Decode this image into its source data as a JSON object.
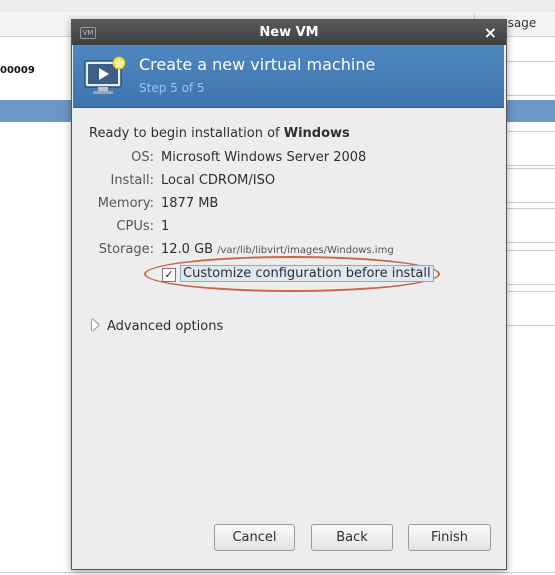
{
  "background": {
    "column_header": "usage",
    "row_label": "00009"
  },
  "dialog": {
    "title": "New VM",
    "app_icon_text": "VM",
    "close_glyph": "×",
    "banner": {
      "heading": "Create a new virtual machine",
      "step": "Step 5 of 5"
    },
    "ready_prefix": "Ready to begin installation of ",
    "os_name": "Windows",
    "details": [
      {
        "label": "OS:",
        "value": "Microsoft Windows Server 2008"
      },
      {
        "label": "Install:",
        "value": "Local CDROM/ISO"
      },
      {
        "label": "Memory:",
        "value": "1877 MB"
      },
      {
        "label": "CPUs:",
        "value": "1"
      },
      {
        "label": "Storage:",
        "value": "12.0 GB",
        "path": "/var/lib/libvirt/images/Windows.img"
      }
    ],
    "customize": {
      "label": "Customize configuration before install",
      "checked": true,
      "check_glyph": "✓"
    },
    "advanced_label": "Advanced options",
    "buttons": {
      "cancel": "Cancel",
      "back": "Back",
      "finish": "Finish"
    }
  },
  "colors": {
    "banner": "#4a82bc",
    "highlight_oval": "#c8664a",
    "selected_row": "#6d97c4"
  }
}
